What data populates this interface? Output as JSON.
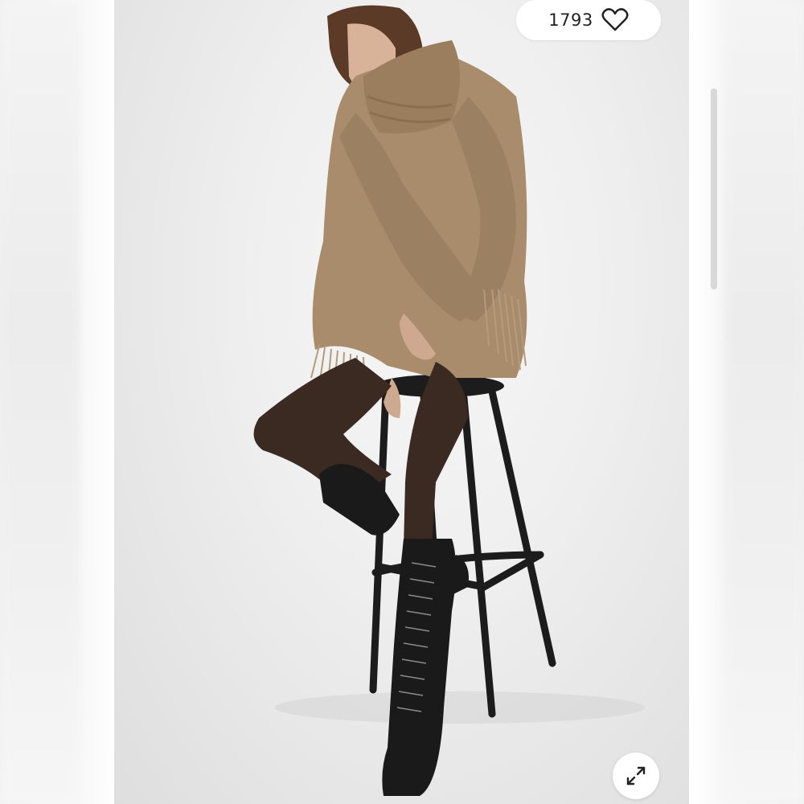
{
  "like": {
    "count": "1793",
    "icon": "heart-outline-icon"
  },
  "expand": {
    "icon": "expand-arrows-icon"
  },
  "colors": {
    "sweater": "#a98e6e",
    "tights": "#3a2a22",
    "boots": "#1a1a1a",
    "stool": "#1c1c1c",
    "backdrop": "#ececec"
  }
}
